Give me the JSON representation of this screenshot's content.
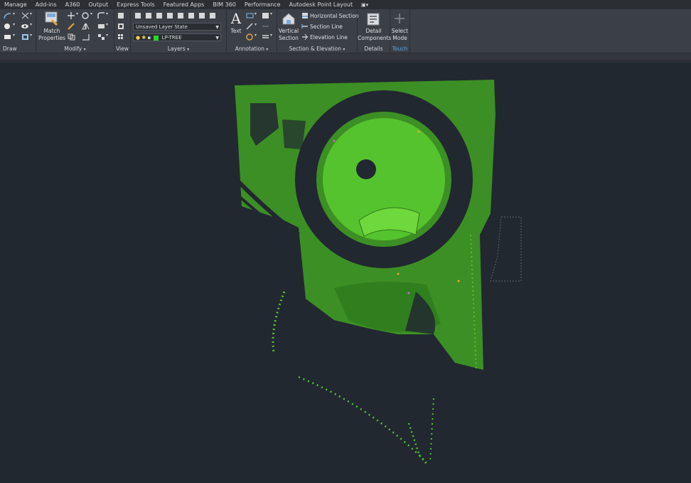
{
  "tabs": [
    "Manage",
    "Add-ins",
    "A360",
    "Output",
    "Express Tools",
    "Featured Apps",
    "BIM 360",
    "Performance",
    "Autodesk Point Layout"
  ],
  "panels": {
    "draw": "Draw",
    "modify": "Modify",
    "view": "View",
    "layers": "Layers",
    "annotation": "Annotation",
    "section_elevation": "Section & Elevation",
    "details": "Details",
    "touch": "Touch"
  },
  "buttons": {
    "match_properties_1": "Match",
    "match_properties_2": "Properties",
    "text": "Text",
    "vertical_section_1": "Vertical",
    "vertical_section_2": "Section",
    "horizontal_section": "Horizontal Section",
    "section_line": "Section Line",
    "elevation_line": "Elevation Line",
    "detail_components_1": "Detail",
    "detail_components_2": "Components",
    "select_mode_1": "Select",
    "select_mode_2": "Mode"
  },
  "layers": {
    "layer_state": "Unsaved Layer State",
    "current_layer": "LP-TREE"
  },
  "colors": {
    "canvas_bg": "#212830",
    "ribbon_bg": "#3b4047",
    "tree_green": "#4fbf2a",
    "touch_label": "#5aa9e6"
  }
}
